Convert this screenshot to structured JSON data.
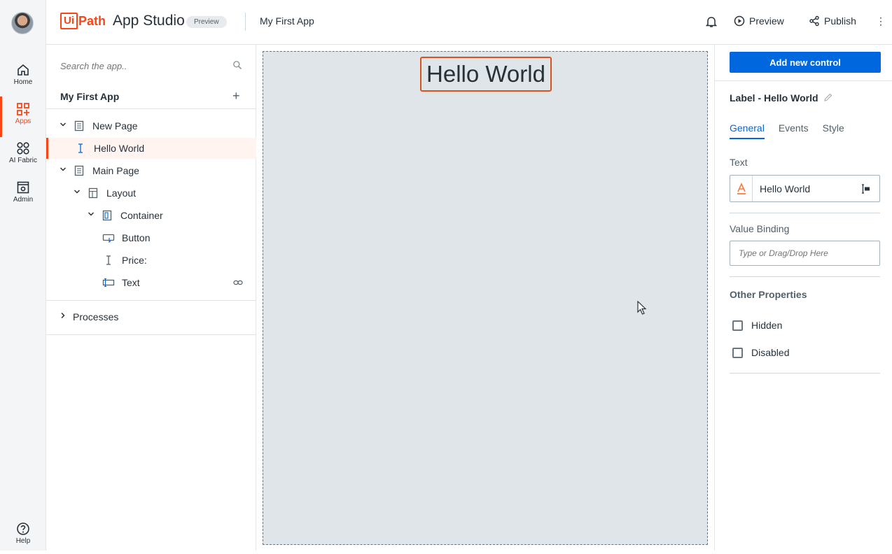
{
  "rail": {
    "items": [
      {
        "label": "Home"
      },
      {
        "label": "Apps"
      },
      {
        "label": "AI Fabric"
      },
      {
        "label": "Admin"
      }
    ],
    "help_label": "Help"
  },
  "topbar": {
    "logo_ui": "Ui",
    "logo_path": "Path",
    "product": "App Studio",
    "badge": "Preview",
    "app_name": "My First App",
    "preview_label": "Preview",
    "publish_label": "Publish",
    "more_glyph": "⋮"
  },
  "tree": {
    "search_placeholder": "Search the app..",
    "header": "My First App",
    "add_glyph": "+",
    "nodes": [
      {
        "label": "New Page"
      },
      {
        "label": "Hello World"
      },
      {
        "label": "Main Page"
      },
      {
        "label": "Layout"
      },
      {
        "label": "Container"
      },
      {
        "label": "Button"
      },
      {
        "label": "Price:"
      },
      {
        "label": "Text"
      }
    ],
    "processes_label": "Processes"
  },
  "canvas": {
    "label_text": "Hello World"
  },
  "props": {
    "add_button": "Add new control",
    "title": "Label - Hello World",
    "tabs": [
      {
        "label": "General"
      },
      {
        "label": "Events"
      },
      {
        "label": "Style"
      }
    ],
    "text_label": "Text",
    "text_value": "Hello World",
    "text_prefix_glyph": "A",
    "binding_label": "Value Binding",
    "binding_placeholder": "Type or Drag/Drop Here",
    "other_props": "Other Properties",
    "hidden_label": "Hidden",
    "disabled_label": "Disabled"
  },
  "colors": {
    "brand": "#fa4616",
    "primary": "#0067df",
    "canvas_bg": "#e0e5e9"
  }
}
